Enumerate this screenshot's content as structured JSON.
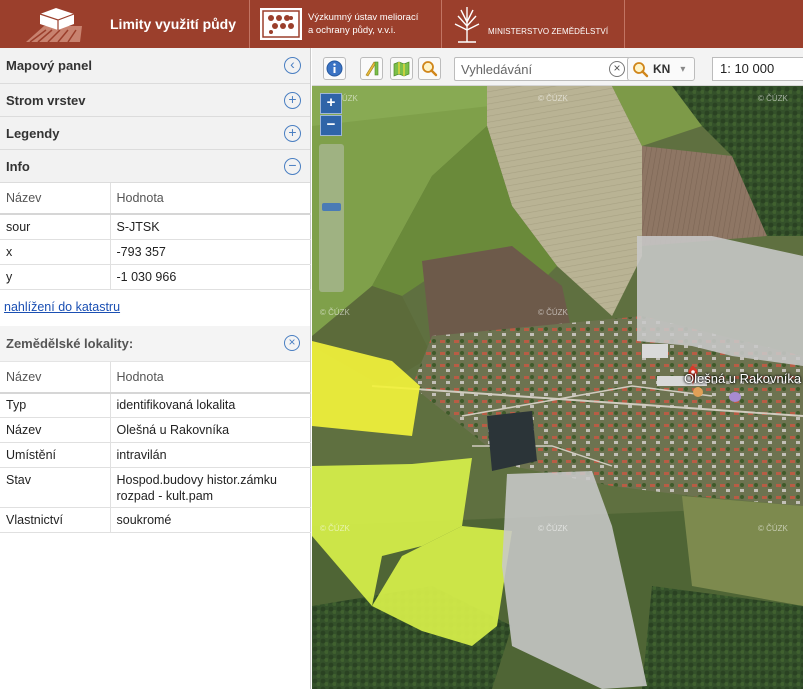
{
  "header": {
    "app_title": "Limity využití půdy",
    "vumop_line1": "Výzkumný ústav meliorací",
    "vumop_line2": "a ochrany půdy, v.v.i.",
    "ministry": "MINISTERSTVO ZEMĚDĚLSTVÍ",
    "bg_color": "#9b3f2c"
  },
  "sidebar": {
    "panels": [
      {
        "label": "Mapový panel",
        "icon": "collapse-left-icon"
      },
      {
        "label": "Strom vrstev",
        "icon": "expand-plus-icon"
      },
      {
        "label": "Legendy",
        "icon": "expand-plus-icon"
      },
      {
        "label": "Info",
        "icon": "collapse-minus-icon"
      }
    ],
    "info_table": {
      "col_name": "Název",
      "col_value": "Hodnota",
      "rows": [
        {
          "name": "sour",
          "value": "S-JTSK"
        },
        {
          "name": "x",
          "value": "-793 357"
        },
        {
          "name": "y",
          "value": "-1 030 966"
        }
      ]
    },
    "cadastre_link": "nahlížení do katastru",
    "localities": {
      "title": "Zemědělské lokality:",
      "col_name": "Název",
      "col_value": "Hodnota",
      "rows": [
        {
          "name": "Typ",
          "value": "identifikovaná lokalita"
        },
        {
          "name": "Název",
          "value": "Olešná u Rakovníka"
        },
        {
          "name": "Umístění",
          "value": "intravilán"
        },
        {
          "name": "Stav",
          "value": "Hospod.budovy histor.zámku rozpad - kult.pam"
        },
        {
          "name": "Vlastnictví",
          "value": "soukromé"
        }
      ]
    }
  },
  "toolbar": {
    "search_placeholder": "Vyhledávání",
    "layer_select": "KN",
    "scale": "1: 10 000"
  },
  "map": {
    "zoom_in": "+",
    "zoom_out": "−",
    "place_label": "Olešná u Rakovníka",
    "watermark": "© ČÚZK",
    "colors": {
      "yellow": "#f2f23b",
      "lime": "#d7f04a",
      "gray": "#c8c8c8",
      "pin": "#d63a2a"
    }
  }
}
